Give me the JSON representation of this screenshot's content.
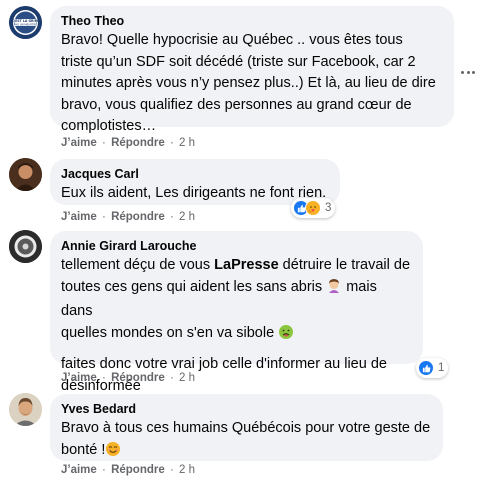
{
  "colors": {
    "bubble": "#f0f2f5",
    "meta": "#65676b",
    "like_blue": "#1877f2",
    "care_yellow": "#f7b125"
  },
  "comments": [
    {
      "author": "Theo Theo",
      "avatar_icon": "badge-avatar-icon",
      "avatar_text": [
        "C'EST LA GRIPE",
        "PAS UN MEURTRE"
      ],
      "text_lines": [
        "Bravo! Quelle hypocrisie au Québec .. vous êtes tous",
        "triste qu’un SDF soit décédé (triste sur Facebook, car 2",
        "minutes après vous n’y pensez plus..) Et là, au lieu de dire",
        "bravo, vous qualifiez des personnes au grand cœur de",
        "complotistes…"
      ],
      "like": "J’aime",
      "reply": "Répondre",
      "time": "2 h"
    },
    {
      "author": "Jacques Carl",
      "avatar_icon": "profile-photo-avatar",
      "text": "Eux ils aident, Les dirigeants ne font rien.",
      "like": "J’aime",
      "reply": "Répondre",
      "time": "2 h",
      "reactions": {
        "icons": [
          "like-reaction-icon",
          "care-reaction-icon"
        ],
        "count": "3"
      }
    },
    {
      "author": "Annie Girard Larouche",
      "avatar_icon": "profile-photo-avatar",
      "line1_pre": "tellement déçu de vous ",
      "line1_mention": "LaPresse",
      "line1_post": " détruire le travail de",
      "line2": "toutes ces gens qui aident les sans abris ",
      "line2_post": " mais dans",
      "line3": "quelles mondes on s'en va sibole ",
      "para2_lines": [
        "faites donc votre vrai job celle d'informer au lieu de",
        "désinformée"
      ],
      "like": "J’aime",
      "reply": "Répondre",
      "time": "2 h",
      "reactions": {
        "icons": [
          "like-reaction-icon"
        ],
        "count": "1"
      }
    },
    {
      "author": "Yves Bedard",
      "avatar_icon": "profile-photo-avatar",
      "text_lines": [
        "Bravo à tous ces humains Québécois pour votre geste de",
        "bonté !"
      ],
      "like": "J’aime",
      "reply": "Répondre",
      "time": "2 h"
    }
  ],
  "separator": "·"
}
